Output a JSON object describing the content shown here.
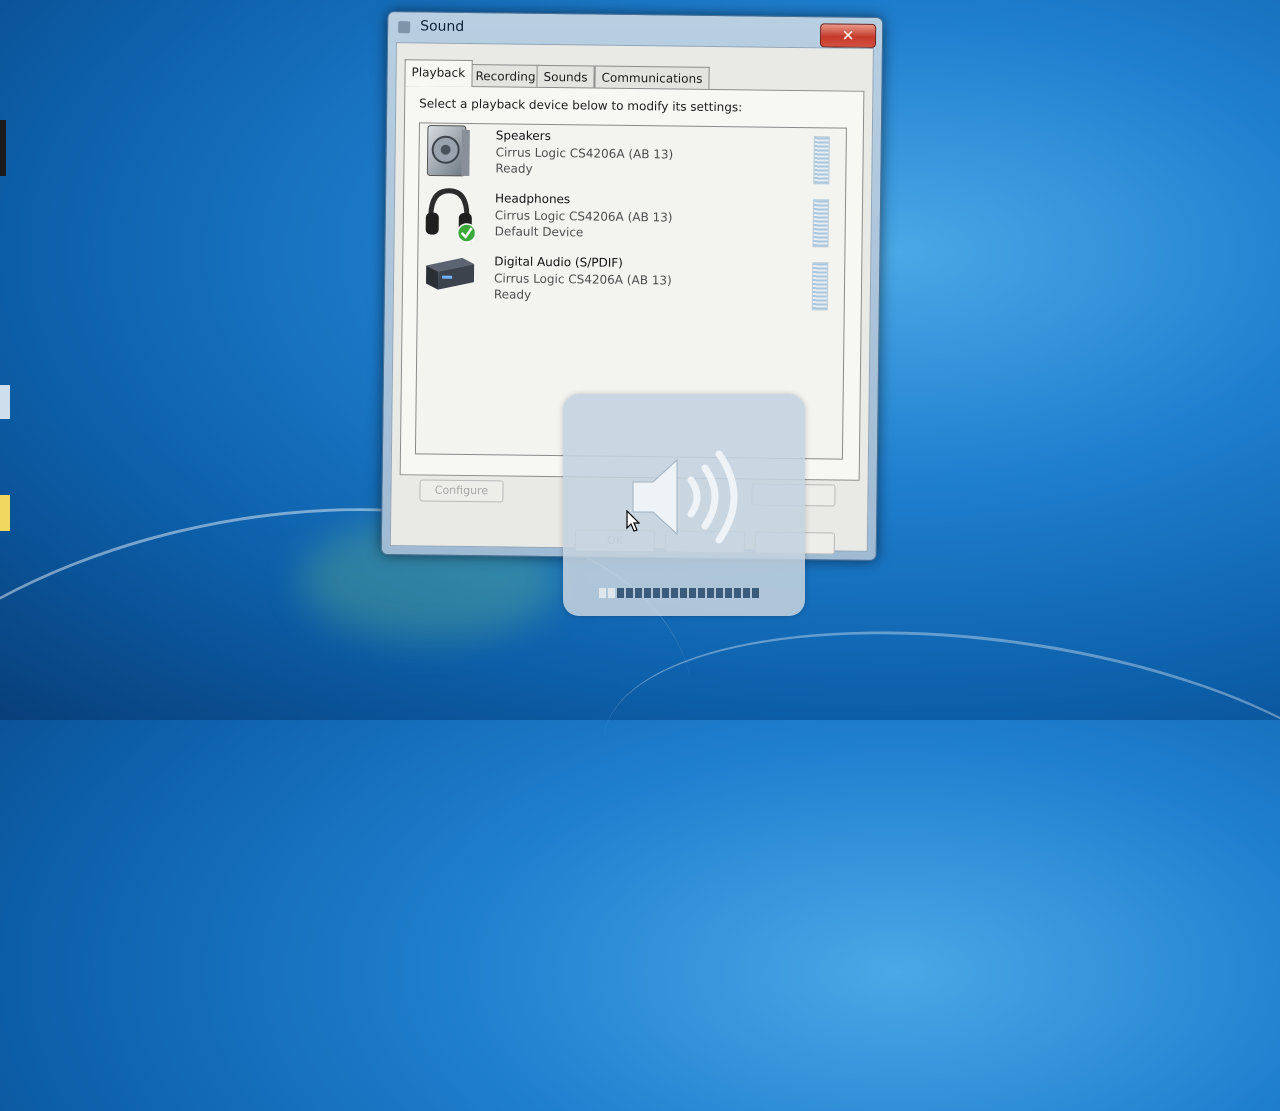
{
  "window": {
    "title": "Sound",
    "close_label": "✕",
    "tabs": [
      {
        "label": "Playback",
        "active": true
      },
      {
        "label": "Recording",
        "active": false
      },
      {
        "label": "Sounds",
        "active": false
      },
      {
        "label": "Communications",
        "active": false
      }
    ],
    "instruction": "Select a playback device below to modify its settings:",
    "devices": [
      {
        "name": "Speakers",
        "driver": "Cirrus Logic CS4206A (AB 13)",
        "status": "Ready",
        "icon": "speaker-icon"
      },
      {
        "name": "Headphones",
        "driver": "Cirrus Logic CS4206A (AB 13)",
        "status": "Default Device",
        "icon": "headphones-icon",
        "default_badge": "check-icon"
      },
      {
        "name": "Digital Audio (S/PDIF)",
        "driver": "Cirrus Logic CS4206A (AB 13)",
        "status": "Ready",
        "icon": "digital-audio-icon"
      }
    ],
    "buttons": {
      "configure": "Configure",
      "ok": "OK"
    }
  },
  "volume_osd": {
    "icon": "speaker-volume-icon",
    "level_fraction": 0.9
  },
  "colors": {
    "desktop": "#1f7fcf",
    "close_button": "#c4392a",
    "default_check": "#3aa83a"
  }
}
